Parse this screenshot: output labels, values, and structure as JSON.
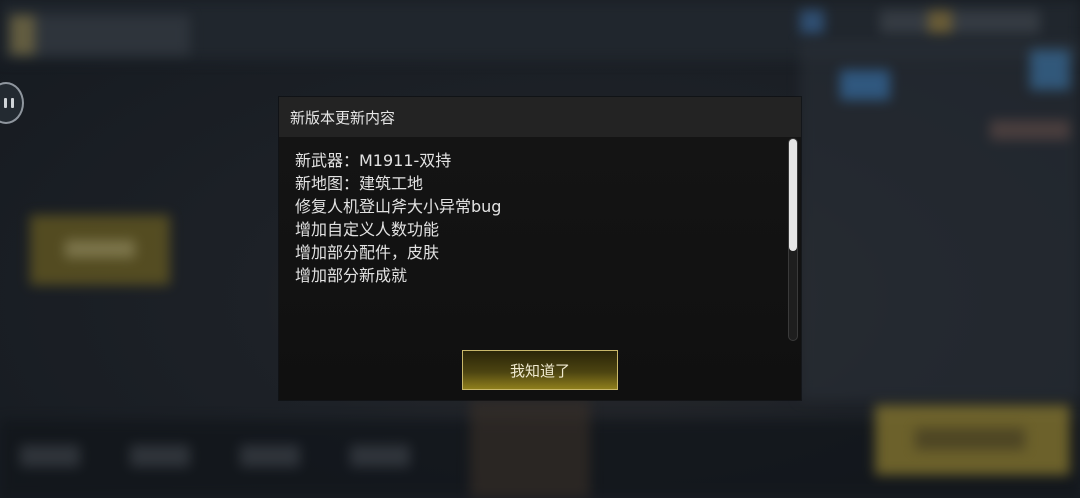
{
  "modal": {
    "title": "新版本更新内容",
    "notes": [
      "新武器：M1911-双持",
      "新地图：建筑工地",
      "修复人机登山斧大小异常bug",
      "增加自定义人数功能",
      "增加部分配件，皮肤",
      "增加部分新成就"
    ],
    "confirm_label": "我知道了"
  },
  "side_button": {
    "icon": "pause-icon"
  },
  "colors": {
    "modal_bg": "#121212",
    "header_bg": "#232323",
    "button_border": "#c9b86a",
    "button_gold": "#8f7f1c"
  }
}
